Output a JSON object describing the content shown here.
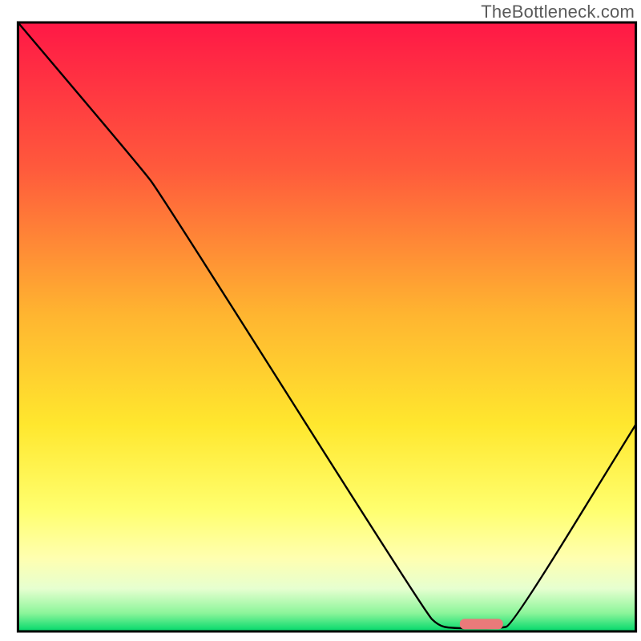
{
  "watermark": "TheBottleneck.com",
  "chart_data": {
    "type": "line",
    "title": "",
    "xlabel": "",
    "ylabel": "",
    "xlim": [
      0,
      100
    ],
    "ylim": [
      0,
      100
    ],
    "gradient_stops": [
      {
        "offset": 0,
        "color": "#ff1846"
      },
      {
        "offset": 24,
        "color": "#ff5a3c"
      },
      {
        "offset": 48,
        "color": "#ffb530"
      },
      {
        "offset": 66,
        "color": "#ffe72e"
      },
      {
        "offset": 80,
        "color": "#ffff6e"
      },
      {
        "offset": 88,
        "color": "#ffffb0"
      },
      {
        "offset": 93,
        "color": "#e6ffd0"
      },
      {
        "offset": 97,
        "color": "#8cf59a"
      },
      {
        "offset": 100,
        "color": "#00d86b"
      }
    ],
    "series": [
      {
        "name": "bottleneck-curve",
        "points": [
          {
            "x": 0,
            "y": 100
          },
          {
            "x": 20,
            "y": 76
          },
          {
            "x": 23,
            "y": 72
          },
          {
            "x": 66,
            "y": 3
          },
          {
            "x": 68,
            "y": 1
          },
          {
            "x": 70,
            "y": 0.5
          },
          {
            "x": 78,
            "y": 0.5
          },
          {
            "x": 80,
            "y": 1
          },
          {
            "x": 100,
            "y": 34
          }
        ]
      }
    ],
    "marker": {
      "name": "optimal-range",
      "x_start": 71.5,
      "x_end": 78.5,
      "y": 1.2,
      "color": "#ea7a7a"
    },
    "frame": {
      "x": 2.8,
      "y": 3.5,
      "w": 96.4,
      "h": 95.0
    }
  }
}
